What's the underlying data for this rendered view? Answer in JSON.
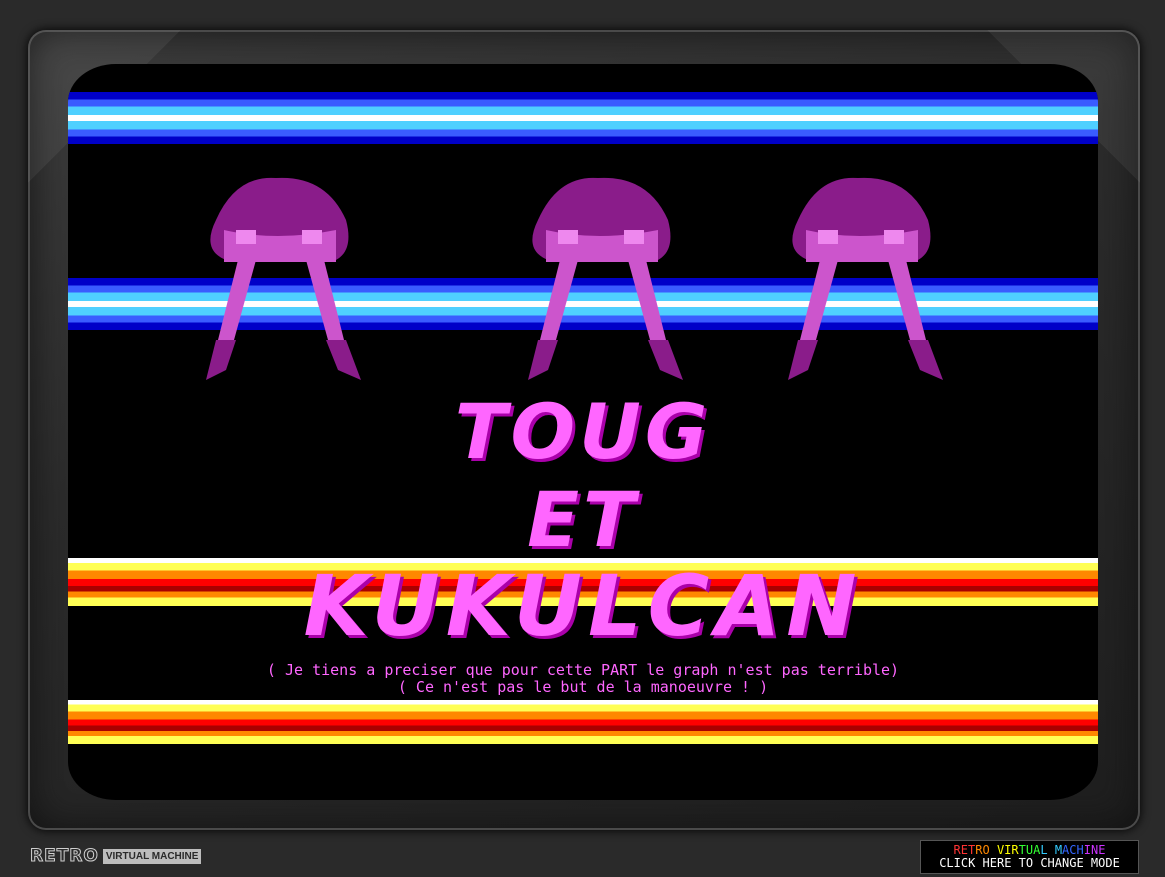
{
  "screen": {
    "title_lines": [
      "TOUG",
      "ET",
      "KUKULCAN"
    ],
    "message_lines": [
      "( Je tiens a preciser que pour cette PART le graph n'est pas terrible)",
      "( Ce n'est pas le but de la manoeuvre ! )"
    ]
  },
  "footer": {
    "logo_main": "RETRO",
    "logo_sub": "VIRTUAL MACHINE",
    "mode_title": "RETRO VIRTUAL MACHINE",
    "mode_action": "CLICK HERE TO CHANGE MODE"
  },
  "colors": {
    "bezel": "#2c2c2c",
    "screen": "#000000",
    "title_magenta": "#ff66ff",
    "dark_magenta": "#aa00aa"
  }
}
